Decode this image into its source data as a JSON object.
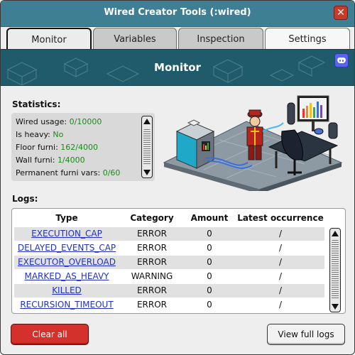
{
  "window": {
    "title": "Wired Creator Tools (:wired)"
  },
  "tabs": [
    {
      "label": "Monitor"
    },
    {
      "label": "Variables"
    },
    {
      "label": "Inspection"
    },
    {
      "label": "Settings"
    }
  ],
  "banner": {
    "title": "Monitor"
  },
  "statistics": {
    "heading": "Statistics:",
    "rows": [
      {
        "label": "Wired usage: ",
        "value": "0/10000"
      },
      {
        "label": "Is heavy: ",
        "value": "No"
      },
      {
        "label": "Floor furni: ",
        "value": "162/4000"
      },
      {
        "label": "Wall furni: ",
        "value": "1/4000"
      },
      {
        "label": "Permanent furni vars: ",
        "value": "0/60"
      }
    ]
  },
  "logs": {
    "heading": "Logs:",
    "columns": [
      "Type",
      "Category",
      "Amount",
      "Latest occurrence"
    ],
    "rows": [
      {
        "type": "EXECUTION_CAP",
        "category": "ERROR",
        "amount": "0",
        "latest": "/"
      },
      {
        "type": "DELAYED_EVENTS_CAP",
        "category": "ERROR",
        "amount": "0",
        "latest": "/"
      },
      {
        "type": "EXECUTOR_OVERLOAD",
        "category": "ERROR",
        "amount": "0",
        "latest": "/"
      },
      {
        "type": "MARKED_AS_HEAVY",
        "category": "WARNING",
        "amount": "0",
        "latest": "/"
      },
      {
        "type": "KILLED",
        "category": "ERROR",
        "amount": "0",
        "latest": "/"
      },
      {
        "type": "RECURSION_TIMEOUT",
        "category": "ERROR",
        "amount": "0",
        "latest": "/"
      }
    ]
  },
  "buttons": {
    "clear_all": "Clear all",
    "view_full_logs": "View full logs"
  },
  "colors": {
    "titlebar": "#3e7f95",
    "banner": "#1f5b6b",
    "value_green": "#1c8a1c",
    "link_blue": "#2233bb",
    "danger_red": "#d4312c"
  }
}
